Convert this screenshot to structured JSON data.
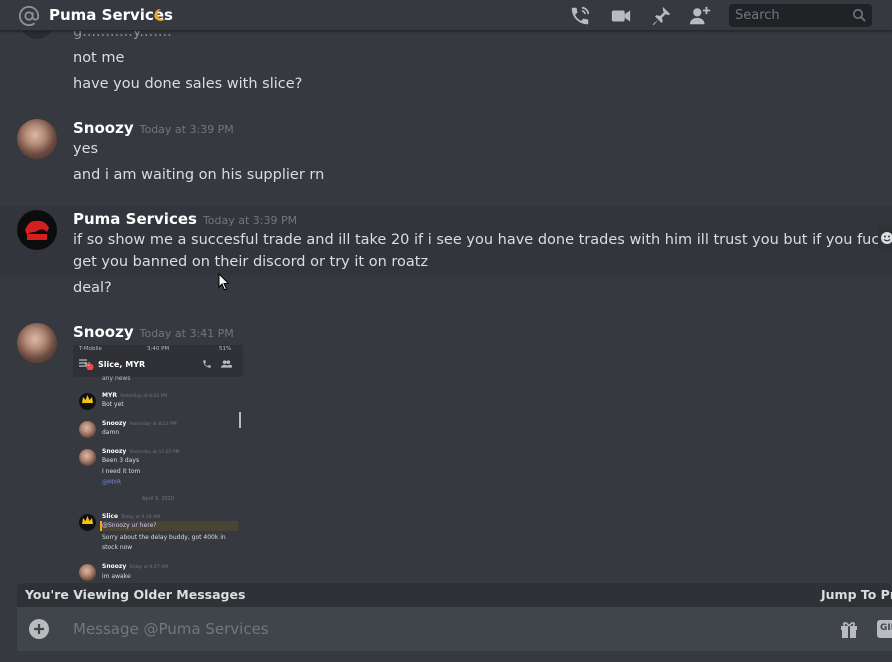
{
  "header": {
    "title": "Puma Services",
    "search_placeholder": "Search"
  },
  "messages": {
    "top_partial": "g...........y.......",
    "group0": {
      "lines": [
        "not me",
        "have you done sales with slice?"
      ]
    },
    "group1": {
      "username": "Snoozy",
      "timestamp": "Today at 3:39 PM",
      "lines": [
        "yes",
        "and i am waiting on his supplier rn"
      ]
    },
    "group2": {
      "username": "Puma Services",
      "timestamp": "Today at 3:39 PM",
      "lines": [
        "if so show me a succesful trade and ill take 20 if i see you have done trades with him ill trust you but if you fuck me over ill",
        "get you banned on their discord or  try it on roatz",
        "deal?"
      ]
    },
    "group3": {
      "username": "Snoozy",
      "timestamp": "Today at 3:41 PM"
    }
  },
  "embed": {
    "carrier": "T-Mobile",
    "time": "3:40 PM",
    "battery": "51%",
    "channel_title": "Slice, MYR",
    "badge": "97",
    "first_line": "any news",
    "posts": [
      {
        "name": "MYR",
        "time": "Yesterday at 8:20 PM",
        "lines": [
          "Bot yet"
        ]
      },
      {
        "name": "Snoozy",
        "time": "Yesterday at 8:22 PM",
        "lines": [
          "damn"
        ]
      },
      {
        "name": "Snoozy",
        "time": "Yesterday at 11:07 PM",
        "lines": [
          "Been 3 days",
          "I need it tom",
          "@MYR"
        ]
      },
      {
        "name": "Slice",
        "time": "Today at 6:19 AM",
        "lines": [
          "@Snoozy ur here?",
          "Sorry about the delay buddy, got 400k in",
          "stock now"
        ]
      },
      {
        "name": "Snoozy",
        "time": "Today at 9:27 AM",
        "lines": [
          "im awake"
        ]
      }
    ],
    "date_divider": "April 9, 2020"
  },
  "older_bar": {
    "label": "You're Viewing Older Messages",
    "jump_label": "Jump To Pre"
  },
  "composer": {
    "placeholder": "Message @Puma Services",
    "gif_label": "GIF"
  },
  "colors": {
    "background": "#36393f",
    "header_text": "#ffffff",
    "muted": "#72767d",
    "mention": "#7289da",
    "highlight": "#32353b"
  }
}
